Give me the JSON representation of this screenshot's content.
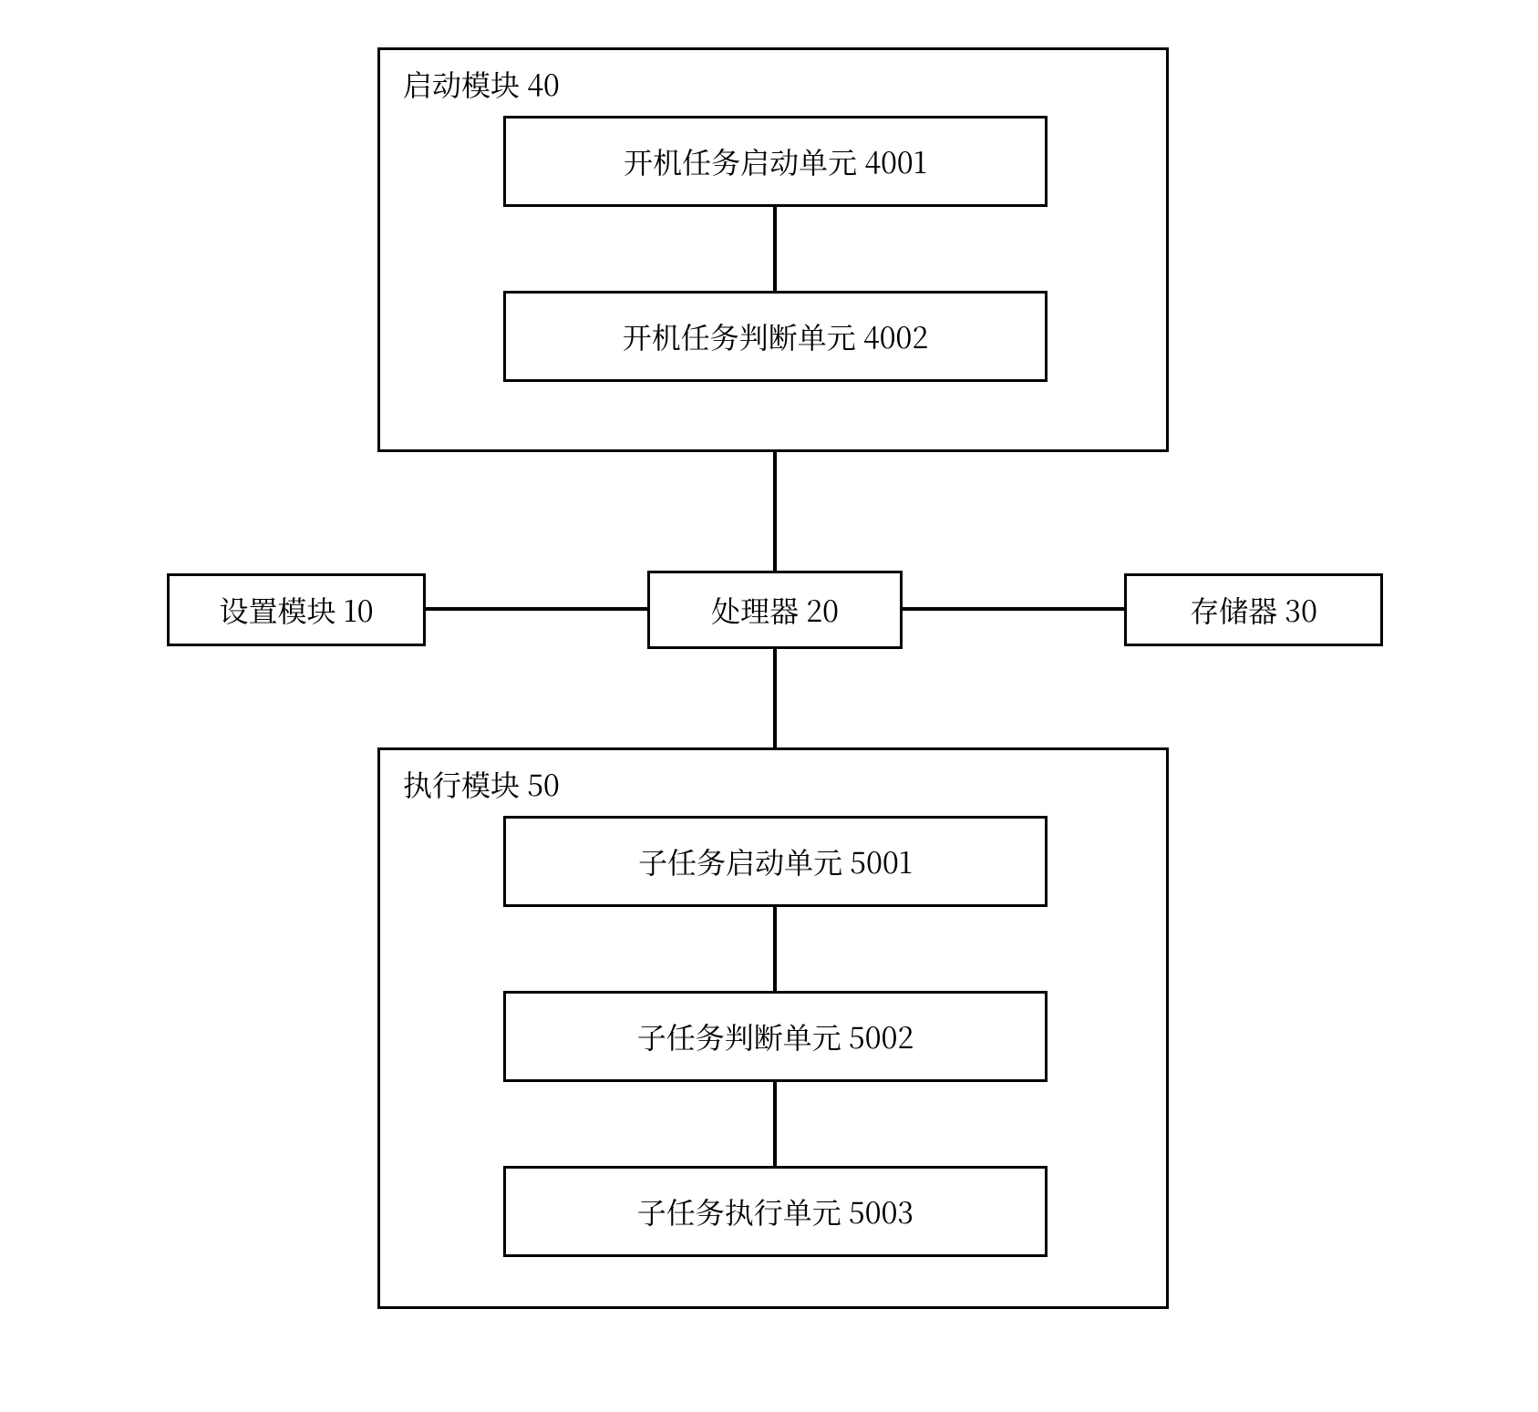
{
  "diagram": {
    "startup_module": {
      "title": "启动模块 40",
      "boot_task_start_unit": "开机任务启动单元 4001",
      "boot_task_judge_unit": "开机任务判断单元 4002"
    },
    "settings_module": "设置模块 10",
    "processor": "处理器 20",
    "storage": "存储器 30",
    "execution_module": {
      "title": "执行模块 50",
      "subtask_start_unit": "子任务启动单元 5001",
      "subtask_judge_unit": "子任务判断单元 5002",
      "subtask_exec_unit": "子任务执行单元 5003"
    }
  }
}
